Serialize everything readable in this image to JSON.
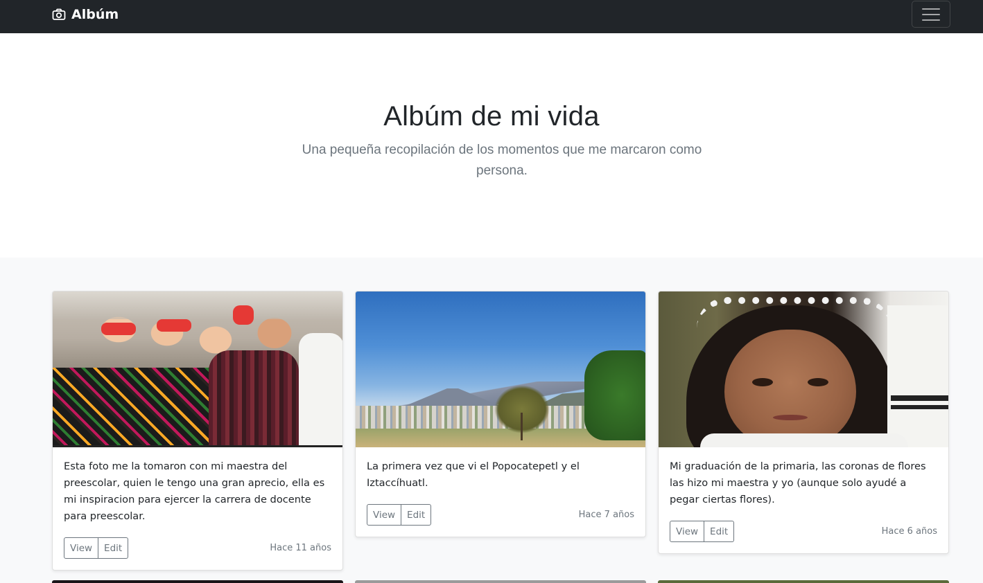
{
  "navbar": {
    "brand": "Albúm"
  },
  "hero": {
    "title": "Albúm de mi vida",
    "lead": "Una pequeña recopilación de los momentos que me marcaron como persona."
  },
  "cards": [
    {
      "text": "Esta foto me la tomaron con mi maestra del preescolar, quien le tengo una gran aprecio, ella es mi inspiracion para ejercer la carrera de docente para preescolar.",
      "view": "View",
      "edit": "Edit",
      "time": "Hace 11 años"
    },
    {
      "text": "La primera vez que vi el Popocatepetl y el Iztaccíhuatl.",
      "view": "View",
      "edit": "Edit",
      "time": "Hace 7 años"
    },
    {
      "text": "Mi graduación de la primaria, las coronas de flores las hizo mi maestra y yo (aunque solo ayudé a pegar ciertas flores).",
      "view": "View",
      "edit": "Edit",
      "time": "Hace 6 años"
    }
  ],
  "colors": {
    "navbar_bg": "#212529",
    "album_bg": "#f8f9fa",
    "muted": "#6c757d"
  }
}
